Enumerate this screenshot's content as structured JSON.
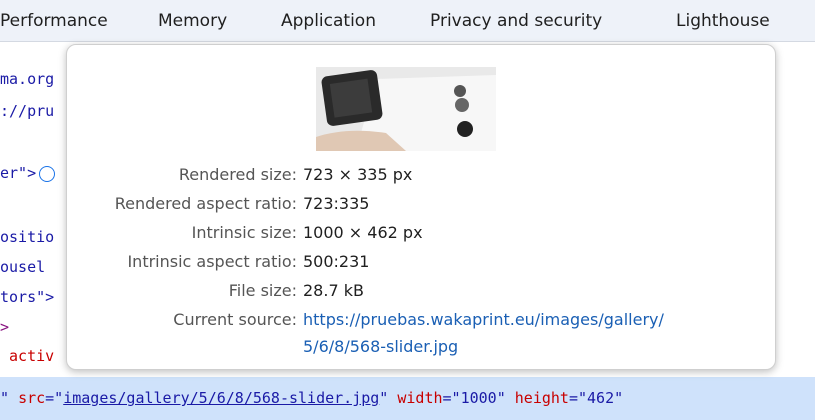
{
  "tabs": [
    {
      "label": "Performance"
    },
    {
      "label": "Memory"
    },
    {
      "label": "Application"
    },
    {
      "label": "Privacy and security"
    },
    {
      "label": "Lighthouse"
    }
  ],
  "code_lines": [
    "ma.org",
    "://pru",
    "er\">",
    "ositio",
    "ousel",
    "tors\">",
    ">",
    " activ"
  ],
  "selected_line": {
    "q0": "\"",
    "src_attr": "src",
    "eq": "=\"",
    "src_val": "images/gallery/5/6/8/568-slider.jpg",
    "q1": "\"",
    "width_attr": "width",
    "width_val": "\"1000\"",
    "height_attr": "height",
    "height_val": "\"462\""
  },
  "tooltip": {
    "rendered_size_label": "Rendered size:",
    "rendered_size_value": "723 × 335 px",
    "rendered_ratio_label": "Rendered aspect ratio:",
    "rendered_ratio_value": "723:335",
    "intrinsic_size_label": "Intrinsic size:",
    "intrinsic_size_value": "1000 × 462 px",
    "intrinsic_ratio_label": "Intrinsic aspect ratio:",
    "intrinsic_ratio_value": "500:231",
    "file_size_label": "File size:",
    "file_size_value": "28.7 kB",
    "current_source_label": "Current source:",
    "current_source_line1": "https://pruebas.wakaprint.eu/images/gallery/",
    "current_source_line2": "5/6/8/568-slider.jpg"
  }
}
